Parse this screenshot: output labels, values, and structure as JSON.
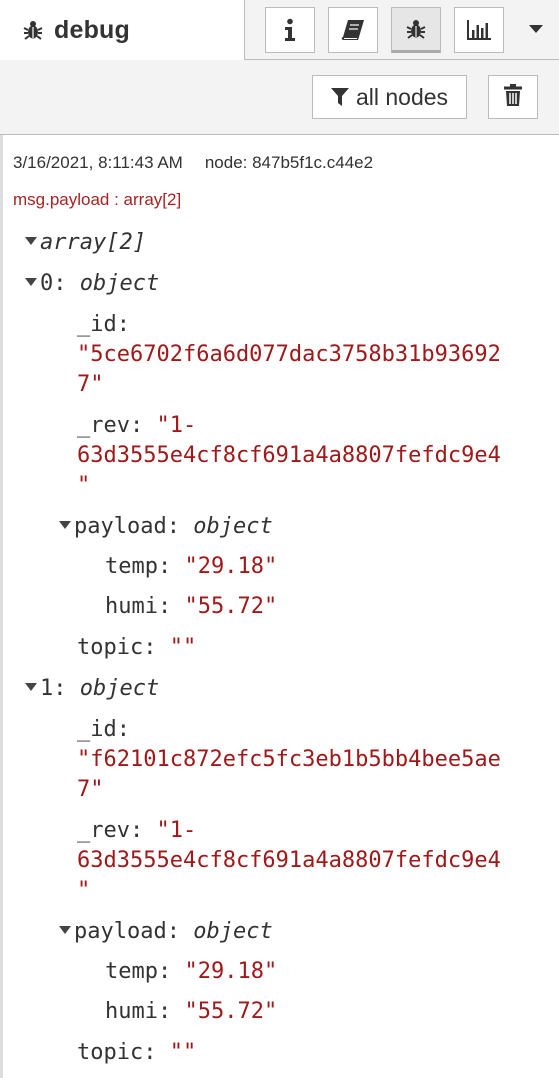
{
  "tabs": {
    "active_label": "debug",
    "buttons": [
      {
        "name": "info",
        "icon": "info-icon"
      },
      {
        "name": "help",
        "icon": "book-icon"
      },
      {
        "name": "debug",
        "icon": "bug-icon"
      },
      {
        "name": "dashboard",
        "icon": "bar-chart-icon"
      }
    ],
    "menu_icon": "chevron-down-icon"
  },
  "toolbar": {
    "filter_label": "all nodes",
    "clear_icon": "trash-icon"
  },
  "message": {
    "timestamp": "3/16/2021, 8:11:43 AM",
    "node": "node: 847b5f1c.c44e2",
    "topic": "msg.payload : array[2]",
    "root": {
      "key": "array[2]"
    },
    "items": [
      {
        "index": "0: ",
        "type": "object",
        "id_key": "_id:",
        "id_line1": "\"5ce6702f6a6d077dac3758b31b93692",
        "id_line2": "7\"",
        "rev_key": "_rev: ",
        "rev_line1": "\"1-",
        "rev_line2": "63d3555e4cf8cf691a4a8807fefdc9e4",
        "rev_line3": "\"",
        "payload_key": "payload: ",
        "payload_type": "object",
        "temp_key": "temp: ",
        "temp_val": "\"29.18\"",
        "humi_key": "humi: ",
        "humi_val": "\"55.72\"",
        "topic_key": "topic: ",
        "topic_val": "\"\""
      },
      {
        "index": "1: ",
        "type": "object",
        "id_key": "_id:",
        "id_line1": "\"f62101c872efc5fc3eb1b5bb4bee5ae",
        "id_line2": "7\"",
        "rev_key": "_rev: ",
        "rev_line1": "\"1-",
        "rev_line2": "63d3555e4cf8cf691a4a8807fefdc9e4",
        "rev_line3": "\"",
        "payload_key": "payload: ",
        "payload_type": "object",
        "temp_key": "temp: ",
        "temp_val": "\"29.18\"",
        "humi_key": "humi: ",
        "humi_val": "\"55.72\"",
        "topic_key": "topic: ",
        "topic_val": "\"\""
      }
    ]
  },
  "colors": {
    "string": "#a01818",
    "topic": "#aa2222",
    "border": "#bbbbbb",
    "toolbar_bg": "#f3f3f3"
  }
}
